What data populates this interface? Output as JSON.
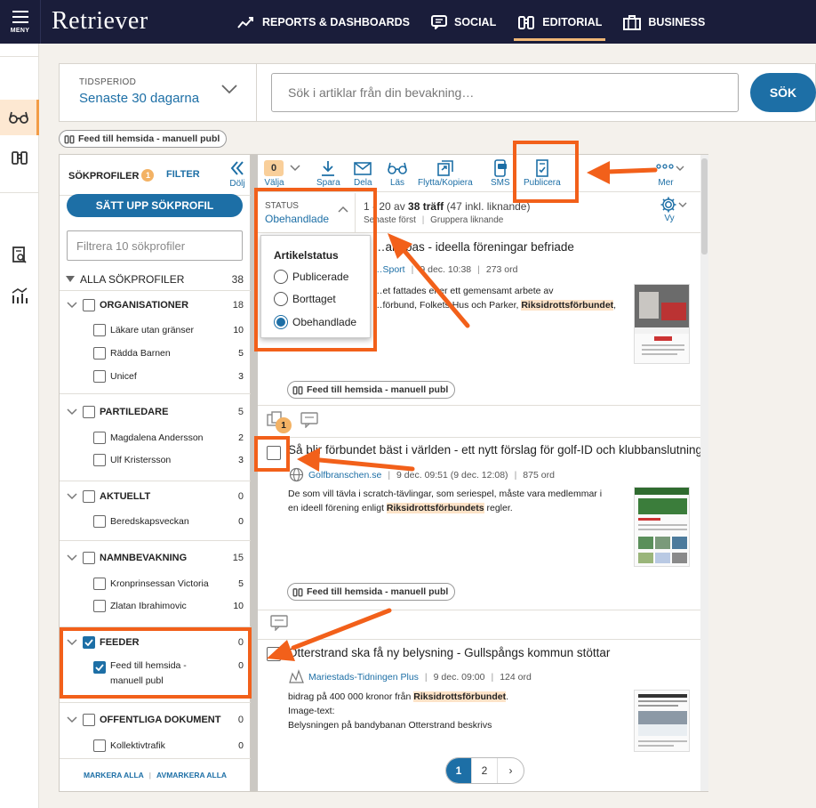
{
  "topbar": {
    "menu_label": "MENY",
    "logo": "Retriever",
    "nav": [
      {
        "label": "REPORTS & DASHBOARDS",
        "icon": "chart-trend-icon"
      },
      {
        "label": "SOCIAL",
        "icon": "chat-icon"
      },
      {
        "label": "EDITORIAL",
        "icon": "binoculars-icon",
        "active": true
      },
      {
        "label": "BUSINESS",
        "icon": "briefcase-icon"
      }
    ]
  },
  "rail": [
    "glasses-icon",
    "binoculars-icon",
    "document-search-icon",
    "analytics-icon"
  ],
  "search": {
    "period_label": "TIDSPERIOD",
    "period_value": "Senaste 30 dagarna",
    "placeholder": "Sök i artiklar från din bevakning…",
    "button": "SÖK"
  },
  "active_filter_chip": "Feed till hemsida - manuell publ",
  "sidebar": {
    "tab_profiles": "SÖKPROFILER",
    "tab_profiles_badge": "1",
    "tab_filter": "FILTER",
    "hide_label": "Dölj",
    "setup_button": "SÄTT UPP SÖKPROFIL",
    "filter_placeholder": "Filtrera 10 sökprofiler",
    "all_profiles": {
      "label": "ALLA SÖKPROFILER",
      "count": "38"
    },
    "groups": [
      {
        "label": "ORGANISATIONER",
        "count": "18",
        "items": [
          {
            "label": "Läkare utan gränser",
            "count": "10"
          },
          {
            "label": "Rädda Barnen",
            "count": "5"
          },
          {
            "label": "Unicef",
            "count": "3"
          }
        ]
      },
      {
        "label": "PARTILEDARE",
        "count": "5",
        "items": [
          {
            "label": "Magdalena Andersson",
            "count": "2"
          },
          {
            "label": "Ulf Kristersson",
            "count": "3"
          }
        ]
      },
      {
        "label": "AKTUELLT",
        "count": "0",
        "items": [
          {
            "label": "Beredskapsveckan",
            "count": "0"
          }
        ]
      },
      {
        "label": "NAMNBEVAKNING",
        "count": "15",
        "items": [
          {
            "label": "Kronprinsessan Victoria",
            "count": "5"
          },
          {
            "label": "Zlatan Ibrahimovic",
            "count": "10"
          }
        ]
      },
      {
        "label": "FEEDER",
        "count": "0",
        "checked": true,
        "items": [
          {
            "label": "Feed till hemsida - manuell publ",
            "count": "0",
            "checked": true
          }
        ]
      },
      {
        "label": "OFFENTLIGA DOKUMENT",
        "count": "0",
        "items": [
          {
            "label": "Kollektivtrafik",
            "count": "0"
          }
        ]
      }
    ],
    "mark_all": "MARKERA ALLA",
    "unmark_all": "AVMARKERA ALLA"
  },
  "toolbar": {
    "selected_count": "0",
    "select_label": "Välja",
    "actions": [
      {
        "label": "Spara",
        "icon": "download-icon"
      },
      {
        "label": "Dela",
        "icon": "mail-icon"
      },
      {
        "label": "Läs",
        "icon": "glasses-icon"
      },
      {
        "label": "Flytta/Kopiera",
        "icon": "move-copy-icon"
      },
      {
        "label": "SMS",
        "icon": "sms-icon"
      },
      {
        "label": "Publicera",
        "icon": "publish-icon"
      }
    ],
    "more_label": "Mer"
  },
  "status": {
    "label": "STATUS",
    "value": "Obehandlade",
    "hits_prefix": "1 - 20 av",
    "hits_total": "38 träff",
    "hits_suffix": "(47 inkl. liknande)",
    "sort": "Senaste först",
    "group": "Gruppera liknande",
    "view_label": "Vy"
  },
  "status_dropdown": {
    "heading": "Artikelstatus",
    "options": [
      {
        "label": "Publicerade",
        "selected": false
      },
      {
        "label": "Borttaget",
        "selected": false
      },
      {
        "label": "Obehandlade",
        "selected": true
      }
    ]
  },
  "articles": [
    {
      "title": "…ar spas - ideella föreningar befriade",
      "source": "…Sport",
      "date": "9 dec. 10:38",
      "words": "273 ord",
      "body_lines": [
        [
          "…et fattades efter ett gemensamt arbete av"
        ],
        [
          "…förbund, Folkets Hus och Parker, ",
          "Riksidrottsförbundet",
          ","
        ]
      ],
      "chip": "Feed till hemsida - manuell publ"
    },
    {
      "title": "Så blir förbundet bäst i världen - ett nytt förslag för golf-ID och klubbanslutning",
      "source": "Golfbranschen.se",
      "date": "9 dec. 09:51 (9 dec. 12:08)",
      "words": "875 ord",
      "badge": "1",
      "body_lines": [
        [
          "De som vill tävla i scratch-tävlingar, som seriespel, måste vara medlemmar i"
        ],
        [
          "en ideell förening enligt ",
          "Riksidrottsförbundets",
          " regler."
        ]
      ],
      "chip": "Feed till hemsida - manuell publ"
    },
    {
      "title": "Otterstrand ska få ny belysning - Gullspångs kommun stöttar",
      "source": "Mariestads-Tidningen Plus",
      "date": "9 dec. 09:00",
      "words": "124 ord",
      "body_lines": [
        [
          "bidrag på 400 000 kronor från ",
          "Riksidrottsförbundet",
          "."
        ],
        [
          "Image-text:"
        ],
        [
          "Belysningen på bandybanan Otterstrand beskrivs"
        ]
      ]
    }
  ],
  "pagination": {
    "pages": [
      "1",
      "2"
    ],
    "current": "1",
    "next": "›"
  },
  "colors": {
    "accent": "#1d6fa6",
    "nav_bg": "#1a1d3a",
    "highlight": "#fde3c8",
    "annotation": "#f2601a",
    "badge": "#f3b264"
  }
}
